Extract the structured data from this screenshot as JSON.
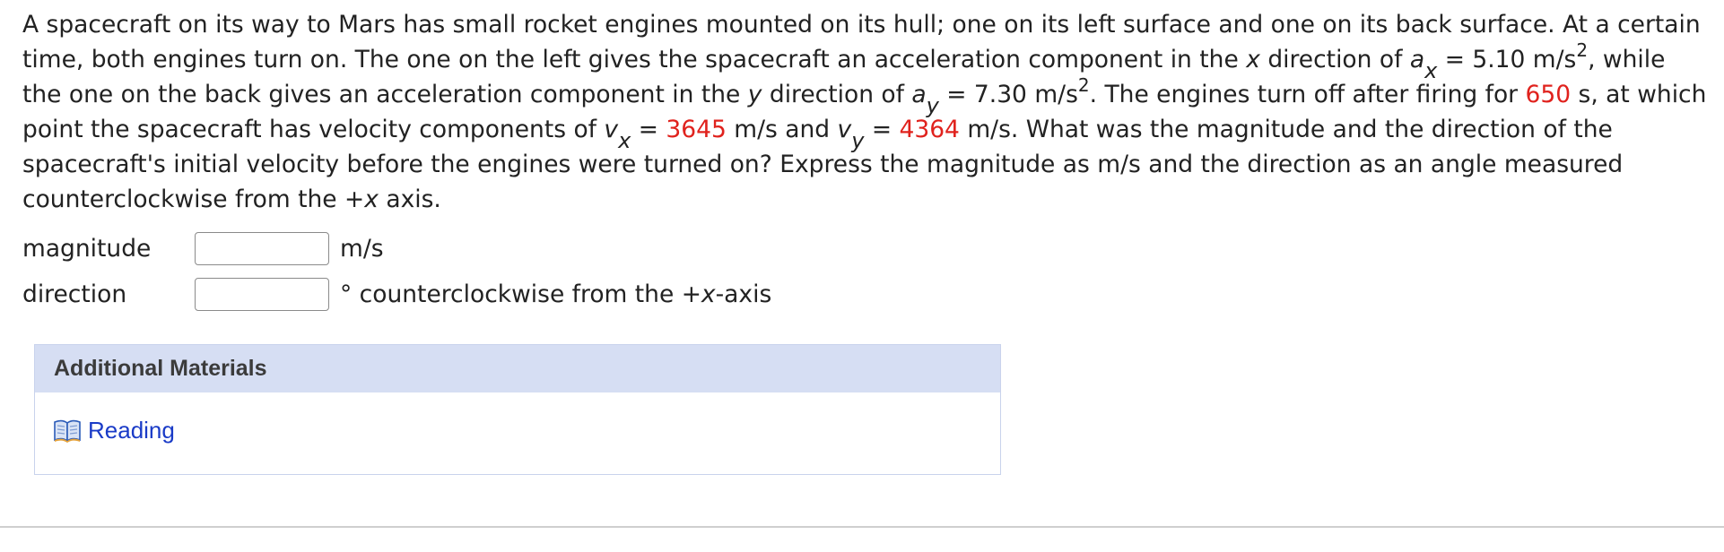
{
  "problem": {
    "t1": "A spacecraft on its way to Mars has small rocket engines mounted on its hull; one on its left surface and one on its back surface. At a certain time, both engines turn on. The one on the left gives the spacecraft an acceleration component in the ",
    "x_word": "x",
    "t2": " direction of ",
    "a_sym": "a",
    "ax_sub": "x",
    "t3": " = 5.10 m/s",
    "pow2": "2",
    "t4": ", while the one on the back gives an acceleration component in the ",
    "y_word": "y",
    "t5": " direction of ",
    "ay_sub": "y",
    "t6": " = 7.30 m/s",
    "t7": ". The engines turn off after firing for ",
    "time_value": "650",
    "t8": " s, at which point the spacecraft has velocity components of ",
    "v_sym": "v",
    "vx_sub": "x",
    "t9": " = ",
    "vx_value": "3645",
    "t10": " m/s and ",
    "vy_sub": "y",
    "t11": " = ",
    "vy_value": "4364",
    "t12": " m/s. What was the magnitude and the direction of the spacecraft's initial velocity before the engines were turned on? Express the magnitude as m/s and the direction as an angle measured counterclockwise from the +",
    "t13": " axis."
  },
  "answers": {
    "magnitude": {
      "label": "magnitude",
      "value": "",
      "unit": "m/s"
    },
    "direction": {
      "label": "direction",
      "value": "",
      "unit_pre": "° counterclockwise from the +",
      "unit_var": "x",
      "unit_post": "-axis"
    }
  },
  "materials": {
    "header": "Additional Materials",
    "link_label": "Reading",
    "link_icon": "book-icon"
  },
  "colors": {
    "highlight": "#e0221d",
    "link": "#1a3bc7",
    "materials_header_bg": "#d6def3",
    "materials_border": "#c9d3ec"
  }
}
